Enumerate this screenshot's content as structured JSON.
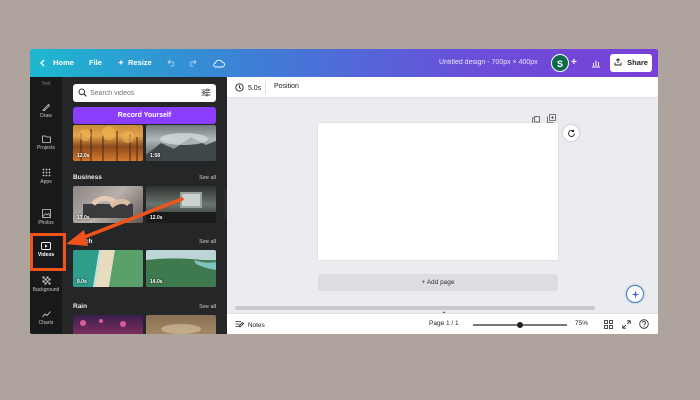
{
  "topbar": {
    "home_label": "Home",
    "file_label": "File",
    "resize_label": "Resize",
    "doc_title": "Untitled design - 700px × 400px",
    "avatar_initial": "S",
    "share_label": "Share"
  },
  "rail": {
    "items": [
      {
        "label": "Text"
      },
      {
        "label": "Draw"
      },
      {
        "label": "Projects"
      },
      {
        "label": "Apps"
      },
      {
        "label": "Photos"
      },
      {
        "label": "Videos"
      },
      {
        "label": "Background"
      },
      {
        "label": "Charts"
      }
    ]
  },
  "panel": {
    "search_placeholder": "Search videos",
    "record_label": "Record Yourself",
    "top_durations": [
      "12.0s",
      "1:58"
    ],
    "sections": [
      {
        "title": "Business",
        "see_all": "See all",
        "durations": [
          "17.0s",
          "12.0s"
        ]
      },
      {
        "title": "Beach",
        "see_all": "See all",
        "durations": [
          "9.0s",
          "14.0s"
        ]
      },
      {
        "title": "Rain",
        "see_all": "See all",
        "durations": []
      }
    ]
  },
  "editor": {
    "duration_label": "5.0s",
    "position_label": "Position",
    "add_page_label": "+ Add page"
  },
  "footer": {
    "notes_label": "Notes",
    "page_indicator": "Page 1 / 1",
    "zoom_label": "75%",
    "zoom_value": 0.5
  },
  "colors": {
    "accent": "#8b3dff",
    "callout": "#f0531c"
  }
}
